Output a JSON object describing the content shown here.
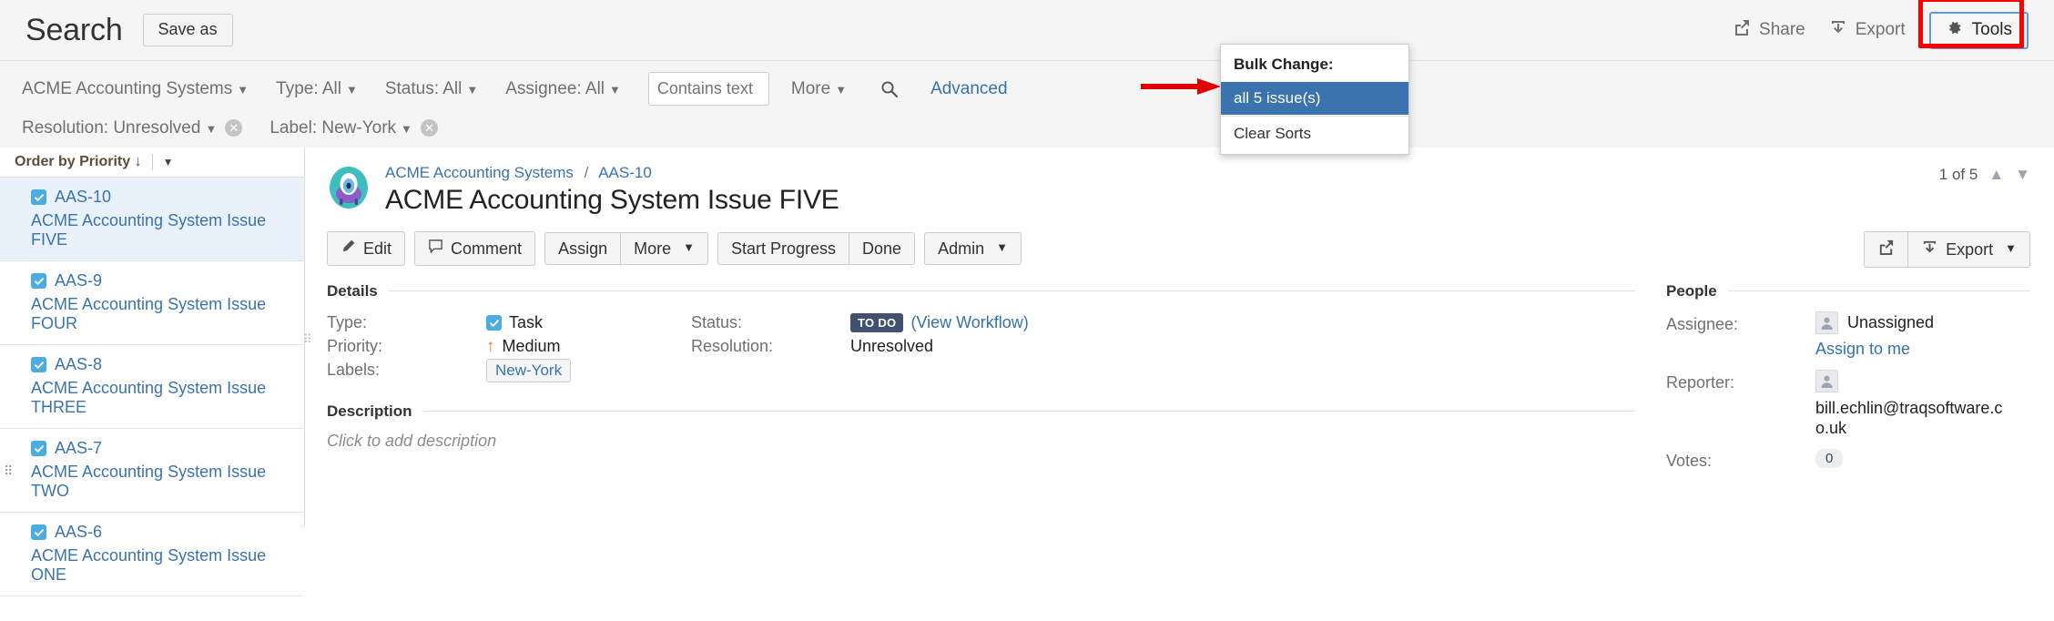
{
  "header": {
    "title": "Search",
    "save_as_label": "Save as",
    "share_label": "Share",
    "share_icon": "share-icon",
    "export_label": "Export",
    "export_icon": "download-icon",
    "tools_label": "Tools",
    "tools_icon": "gear-icon"
  },
  "tools_menu": {
    "heading": "Bulk Change:",
    "items": [
      {
        "label": "all 5 issue(s)",
        "selected": true
      },
      {
        "label": "Clear Sorts",
        "selected": false
      }
    ],
    "highlight_color": "#3b73af"
  },
  "filters": {
    "project": "ACME Accounting Systems",
    "type": "Type: All",
    "status": "Status: All",
    "assignee": "Assignee: All",
    "contains_placeholder": "Contains text",
    "contains_value": "",
    "more": "More",
    "search_icon": "search-icon",
    "advanced": "Advanced",
    "chips": [
      {
        "label": "Resolution: Unresolved"
      },
      {
        "label": "Label: New-York"
      }
    ]
  },
  "sidebar": {
    "order_by": "Order by Priority",
    "sort_arrow": "↓",
    "issues": [
      {
        "key": "AAS-10",
        "summary": "ACME Accounting System Issue FIVE",
        "checked": true,
        "active": true
      },
      {
        "key": "AAS-9",
        "summary": "ACME Accounting System Issue FOUR",
        "checked": true,
        "active": false
      },
      {
        "key": "AAS-8",
        "summary": "ACME Accounting System Issue THREE",
        "checked": true,
        "active": false
      },
      {
        "key": "AAS-7",
        "summary": "ACME Accounting System Issue TWO",
        "checked": true,
        "active": false
      },
      {
        "key": "AAS-6",
        "summary": "ACME Accounting System Issue ONE",
        "checked": true,
        "active": false
      }
    ]
  },
  "issue": {
    "breadcrumb_project": "ACME Accounting Systems",
    "breadcrumb_sep": "/",
    "breadcrumb_key": "AAS-10",
    "title": "ACME Accounting System Issue FIVE",
    "pager": "1 of 5",
    "actions": {
      "edit": "Edit",
      "comment": "Comment",
      "assign": "Assign",
      "more": "More",
      "start_progress": "Start Progress",
      "done": "Done",
      "admin": "Admin",
      "export": "Export"
    },
    "details": {
      "section_title": "Details",
      "type_label": "Type:",
      "type_value": "Task",
      "priority_label": "Priority:",
      "priority_value": "Medium",
      "labels_label": "Labels:",
      "labels_value": "New-York",
      "status_label": "Status:",
      "status_value": "TO DO",
      "view_workflow": "(View Workflow)",
      "resolution_label": "Resolution:",
      "resolution_value": "Unresolved"
    },
    "description": {
      "section_title": "Description",
      "placeholder": "Click to add description"
    },
    "people": {
      "section_title": "People",
      "assignee_label": "Assignee:",
      "assignee_value": "Unassigned",
      "assign_to_me": "Assign to me",
      "reporter_label": "Reporter:",
      "reporter_value": "bill.echlin@traqsoftware.co.uk",
      "votes_label": "Votes:",
      "votes_value": "0"
    }
  }
}
